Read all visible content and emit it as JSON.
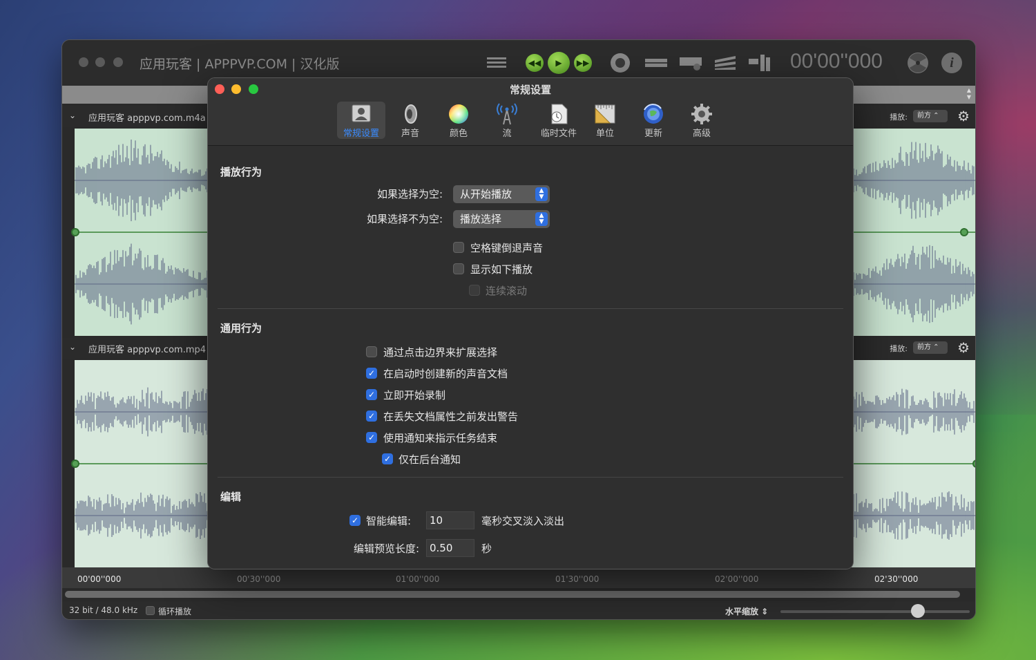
{
  "main_window": {
    "title": "应用玩客 | APPPVP.COM | 汉化版",
    "time": "00'00''000",
    "info_label": "i"
  },
  "tracks": [
    {
      "name": "应用玩客 apppvp.com.m4a",
      "playback_label": "播放:",
      "playback_value": "前方"
    },
    {
      "name": "应用玩客 apppvp.com.mp4",
      "playback_label": "播放:",
      "playback_value": "前方"
    }
  ],
  "ruler": [
    "00'00''000",
    "00'30''000",
    "01'00''000",
    "01'30''000",
    "02'00''000",
    "02'30''000"
  ],
  "status": {
    "format": "32 bit / 48.0 kHz",
    "loop_label": "循环播放",
    "zoom_label": "水平缩放",
    "zoom_level": 0.73
  },
  "prefs": {
    "title": "常规设置",
    "tabs": [
      {
        "label": "常规设置",
        "icon": "general-icon",
        "active": true
      },
      {
        "label": "声音",
        "icon": "speaker-icon"
      },
      {
        "label": "颜色",
        "icon": "color-wheel-icon"
      },
      {
        "label": "流",
        "icon": "broadcast-tower-icon"
      },
      {
        "label": "临时文件",
        "icon": "temp-file-icon"
      },
      {
        "label": "单位",
        "icon": "ruler-icon"
      },
      {
        "label": "更新",
        "icon": "update-globe-icon"
      },
      {
        "label": "高级",
        "icon": "gear-icon"
      }
    ],
    "playback": {
      "title": "播放行为",
      "if_empty_label": "如果选择为空:",
      "if_empty_value": "从开始播放",
      "if_not_empty_label": "如果选择不为空:",
      "if_not_empty_value": "播放选择",
      "space_rewind": {
        "label": "空格键倒退声音",
        "checked": false
      },
      "show_playback": {
        "label": "显示如下播放",
        "checked": false
      },
      "continuous_scroll": {
        "label": "连续滚动",
        "checked": false,
        "disabled": true
      }
    },
    "general": {
      "title": "通用行为",
      "items": [
        {
          "label": "通过点击边界来扩展选择",
          "checked": false
        },
        {
          "label": "在启动时创建新的声音文档",
          "checked": true
        },
        {
          "label": "立即开始录制",
          "checked": true
        },
        {
          "label": "在丢失文档属性之前发出警告",
          "checked": true
        },
        {
          "label": "使用通知来指示任务结束",
          "checked": true
        },
        {
          "label": "仅在后台通知",
          "checked": true
        }
      ]
    },
    "editing": {
      "title": "编辑",
      "smart_edit_label": "智能编辑:",
      "smart_edit_checked": true,
      "smart_edit_value": "10",
      "smart_edit_unit": "毫秒交叉淡入淡出",
      "preview_label": "编辑预览长度:",
      "preview_value": "0.50",
      "preview_unit": "秒"
    }
  },
  "colors": {
    "accent": "#2f6fe0",
    "active_tab_text": "#3a8bff",
    "waveform_bg": "#c9e3d0",
    "waveform": "#5b6583",
    "play_green": "#5fb02a"
  }
}
